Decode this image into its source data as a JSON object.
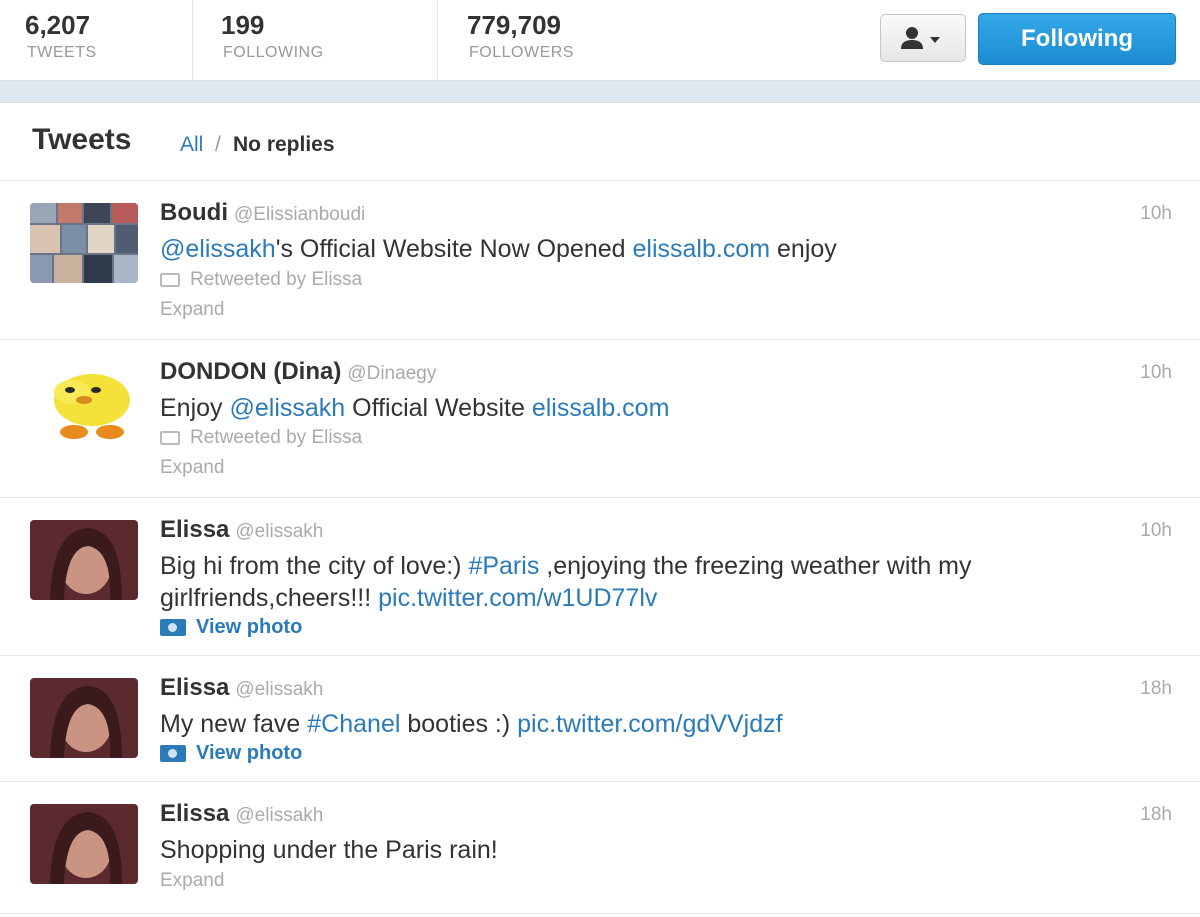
{
  "stats": {
    "tweets": {
      "value": "6,207",
      "label": "TWEETS"
    },
    "following": {
      "value": "199",
      "label": "FOLLOWING"
    },
    "followers": {
      "value": "779,709",
      "label": "FOLLOWERS"
    }
  },
  "actions": {
    "follow_label": "Following",
    "user_menu_icon": "person-dropdown-icon"
  },
  "timeline": {
    "title": "Tweets",
    "filter_all": "All",
    "filter_sep": "/",
    "filter_no_replies": "No replies"
  },
  "tweets": [
    {
      "name": "Boudi",
      "handle": "@Elissianboudi",
      "time": "10h",
      "text_parts": [
        "@elissakh",
        "'s Official Website Now Opened ",
        "elissalb.com",
        " enjoy"
      ],
      "retweeted_by": "Retweeted by Elissa",
      "action": "Expand"
    },
    {
      "name": "DONDON (Dina)",
      "handle": "@Dinaegy",
      "time": "10h",
      "text_parts": [
        "Enjoy ",
        "@elissakh",
        " Official Website ",
        "elissalb.com"
      ],
      "retweeted_by": "Retweeted by Elissa",
      "action": "Expand"
    },
    {
      "name": "Elissa",
      "handle": "@elissakh",
      "time": "10h",
      "text_parts": [
        "Big hi from the city of love:) ",
        "#Paris",
        " ,enjoying the freezing weather with my girlfriends,cheers!!! ",
        "pic.twitter.com/w1UD77lv"
      ],
      "action": "View photo"
    },
    {
      "name": "Elissa",
      "handle": "@elissakh",
      "time": "18h",
      "text_parts": [
        "My new fave ",
        "#Chanel",
        " booties :) ",
        "pic.twitter.com/gdVVjdzf"
      ],
      "action": "View photo"
    },
    {
      "name": "Elissa",
      "handle": "@elissakh",
      "time": "18h",
      "text_parts": [
        "Shopping under the Paris rain!"
      ],
      "action": "Expand"
    }
  ],
  "colors": {
    "link": "#2b7bb9",
    "follow_button": "#1d8cd2",
    "muted": "#aaaaaa"
  }
}
